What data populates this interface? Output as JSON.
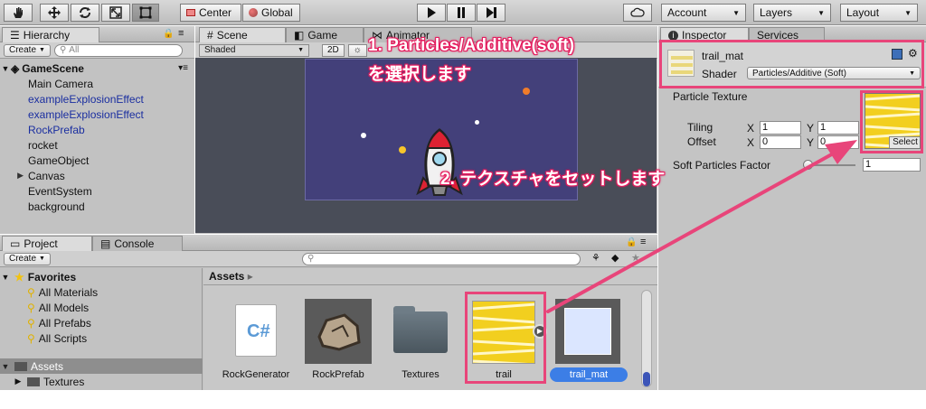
{
  "toolbar": {
    "pivot_label": "Center",
    "space_label": "Global",
    "account_label": "Account",
    "layers_label": "Layers",
    "layout_label": "Layout"
  },
  "hierarchy": {
    "tab_label": "Hierarchy",
    "create_label": "Create",
    "search_placeholder": "All",
    "scene_name": "GameScene",
    "items": [
      {
        "label": "Main Camera",
        "color": "black",
        "expandable": false
      },
      {
        "label": "exampleExplosionEffect",
        "color": "blue",
        "expandable": false
      },
      {
        "label": "exampleExplosionEffect",
        "color": "blue",
        "expandable": false
      },
      {
        "label": "RockPrefab",
        "color": "blue",
        "expandable": false
      },
      {
        "label": "rocket",
        "color": "black",
        "expandable": false
      },
      {
        "label": "GameObject",
        "color": "black",
        "expandable": false
      },
      {
        "label": "Canvas",
        "color": "black",
        "expandable": true
      },
      {
        "label": "EventSystem",
        "color": "black",
        "expandable": false
      },
      {
        "label": "background",
        "color": "black",
        "expandable": false
      }
    ]
  },
  "scene": {
    "tab_scene": "Scene",
    "tab_game": "Game",
    "tab_animator": "Animator",
    "shading_label": "Shaded",
    "mode_2d_label": "2D"
  },
  "project": {
    "tab_project": "Project",
    "tab_console": "Console",
    "create_label": "Create",
    "favorites_label": "Favorites",
    "favorites": [
      "All Materials",
      "All Models",
      "All Prefabs",
      "All Scripts"
    ],
    "assets_root_label": "Assets",
    "textures_folder_label": "Textures",
    "breadcrumb_assets": "Assets",
    "assets": [
      {
        "name": "RockGenerator",
        "kind": "script"
      },
      {
        "name": "RockPrefab",
        "kind": "prefab"
      },
      {
        "name": "Textures",
        "kind": "folder"
      },
      {
        "name": "trail",
        "kind": "texture"
      },
      {
        "name": "trail_mat",
        "kind": "material"
      }
    ]
  },
  "inspector": {
    "tab_inspector": "Inspector",
    "tab_services": "Services",
    "material_name": "trail_mat",
    "shader_label": "Shader",
    "shader_value": "Particles/Additive (Soft)",
    "particle_texture_label": "Particle Texture",
    "tiling_label": "Tiling",
    "offset_label": "Offset",
    "x_label": "X",
    "y_label": "Y",
    "tiling_x": "1",
    "tiling_y": "1",
    "offset_x": "0",
    "offset_y": "0",
    "select_label": "Select",
    "soft_factor_label": "Soft Particles Factor",
    "soft_factor_value": "1",
    "soft_factor_fraction": 0.0
  },
  "annotations": {
    "step1_line1": "1. Particles/Additive(soft)",
    "step1_line2": "を選択します",
    "step2": "2. テクスチャをセットします"
  },
  "colors": {
    "annotation_pink": "#e8457a",
    "selection_blue": "#3c7ee6",
    "texture_yellow": "#f2cf1f",
    "scene_bg": "#43407a"
  }
}
